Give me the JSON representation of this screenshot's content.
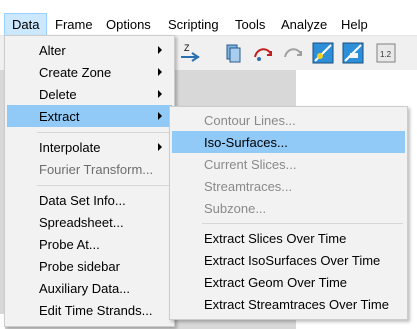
{
  "menubar": {
    "items": [
      "Data",
      "Frame",
      "Options",
      "Scripting",
      "Tools",
      "Analyze",
      "Help"
    ],
    "active": "Data"
  },
  "toolbar": {
    "icons": [
      "zoom-axis-icon",
      "slice-icon",
      "rotate-icon",
      "rotate-disabled-icon",
      "iso-surface-icon",
      "contour-icon",
      "value-label-icon"
    ],
    "label_12": "1.2"
  },
  "data_menu": {
    "items": [
      {
        "label": "Alter",
        "has_submenu": true,
        "disabled": false
      },
      {
        "label": "Create Zone",
        "has_submenu": true,
        "disabled": false
      },
      {
        "label": "Delete",
        "has_submenu": true,
        "disabled": false
      },
      {
        "label": "Extract",
        "has_submenu": true,
        "disabled": false,
        "highlighted": true
      },
      {
        "label": "Interpolate",
        "has_submenu": true,
        "disabled": false
      },
      {
        "label": "Fourier Transform...",
        "has_submenu": false,
        "disabled": true
      },
      {
        "label": "Data Set Info...",
        "has_submenu": false,
        "disabled": false
      },
      {
        "label": "Spreadsheet...",
        "has_submenu": false,
        "disabled": false
      },
      {
        "label": "Probe At...",
        "has_submenu": false,
        "disabled": false
      },
      {
        "label": "Probe sidebar",
        "has_submenu": false,
        "disabled": false
      },
      {
        "label": "Auxiliary Data...",
        "has_submenu": false,
        "disabled": false
      },
      {
        "label": "Edit Time Strands...",
        "has_submenu": false,
        "disabled": false
      }
    ]
  },
  "extract_submenu": {
    "items": [
      {
        "label": "Contour Lines...",
        "disabled": true
      },
      {
        "label": "Iso-Surfaces...",
        "disabled": false,
        "highlighted": true
      },
      {
        "label": "Current Slices...",
        "disabled": true
      },
      {
        "label": "Streamtraces...",
        "disabled": true
      },
      {
        "label": "Subzone...",
        "disabled": true
      },
      {
        "label": "Extract Slices Over Time",
        "disabled": false
      },
      {
        "label": "Extract IsoSurfaces Over Time",
        "disabled": false
      },
      {
        "label": "Extract Geom Over Time",
        "disabled": false
      },
      {
        "label": "Extract Streamtraces Over Time",
        "disabled": false
      }
    ]
  },
  "colors": {
    "highlight": "#91c9f7",
    "menubar_active": "#cce8ff",
    "menu_bg": "#f2f2f2"
  }
}
